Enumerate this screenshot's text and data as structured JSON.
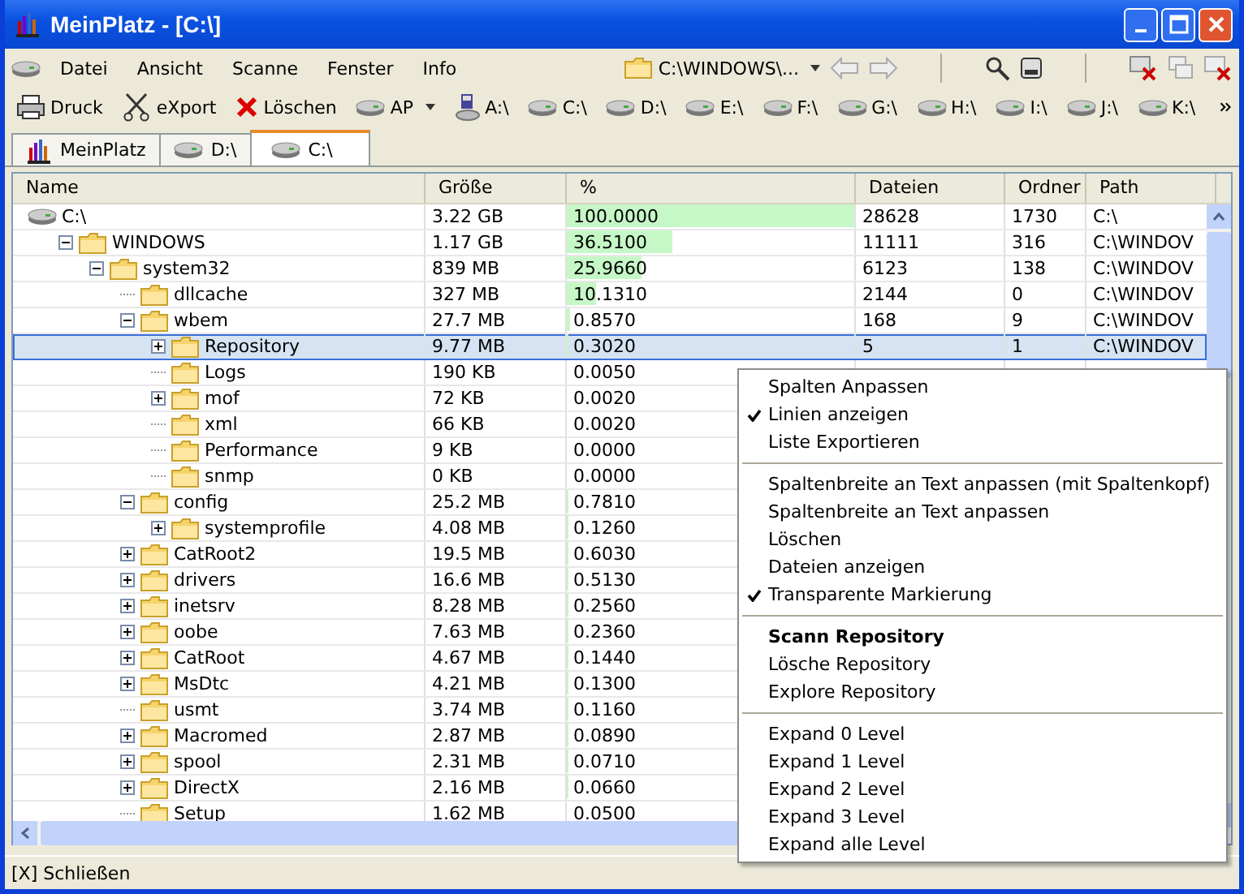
{
  "window": {
    "title": "MeinPlatz - [C:\\]"
  },
  "menu": [
    "Datei",
    "Ansicht",
    "Scanne",
    "Fenster",
    "Info"
  ],
  "address": {
    "value": "C:\\WINDOWS\\..."
  },
  "toolbar": [
    {
      "label": "Druck",
      "kind": "print"
    },
    {
      "label": "eXport",
      "kind": "export"
    },
    {
      "label": "Löschen",
      "kind": "delete"
    },
    {
      "label": "AP",
      "kind": "dropdown"
    },
    {
      "label": "A:\\",
      "kind": "floppy"
    },
    {
      "label": "C:\\",
      "kind": "drive"
    },
    {
      "label": "D:\\",
      "kind": "drive"
    },
    {
      "label": "E:\\",
      "kind": "drive"
    },
    {
      "label": "F:\\",
      "kind": "drive"
    },
    {
      "label": "G:\\",
      "kind": "drive"
    },
    {
      "label": "H:\\",
      "kind": "drive"
    },
    {
      "label": "I:\\",
      "kind": "drive"
    },
    {
      "label": "J:\\",
      "kind": "drive"
    },
    {
      "label": "K:\\",
      "kind": "drive"
    }
  ],
  "tabs": [
    {
      "label": "MeinPlatz",
      "kind": "app",
      "selected": false
    },
    {
      "label": "D:\\",
      "kind": "drive",
      "selected": false
    },
    {
      "label": "C:\\",
      "kind": "drive",
      "selected": true
    }
  ],
  "table": {
    "columns": [
      "Name",
      "Größe",
      "%",
      "Dateien",
      "Ordner",
      "Path"
    ],
    "rows": [
      {
        "name": "C:\\",
        "kind": "drive",
        "size": "3.22 GB",
        "pct": "100.0000",
        "level": 1,
        "files": "28628",
        "folders": "1730",
        "path": "C:\\",
        "selected": false,
        "children": [
          {
            "name": "WINDOWS",
            "kind": "folder",
            "expanded": true,
            "size": "1.17 GB",
            "pct": "36.5100",
            "level": 0.365,
            "files": "11111",
            "folders": "316",
            "path": "C:\\WINDOV",
            "selected": false,
            "children": [
              {
                "name": "system32",
                "kind": "folder",
                "expanded": true,
                "size": "839 MB",
                "pct": "25.9660",
                "level": 0.26,
                "files": "6123",
                "folders": "138",
                "path": "C:\\WINDOV",
                "selected": false,
                "children": [
                  {
                    "name": "dllcache",
                    "kind": "folder",
                    "size": "327 MB",
                    "pct": "10.1310",
                    "level": 0.101,
                    "files": "2144",
                    "folders": "0",
                    "path": "C:\\WINDOV",
                    "selected": false
                  },
                  {
                    "name": "wbem",
                    "kind": "folder",
                    "expanded": true,
                    "size": "27.7 MB",
                    "pct": "0.8570",
                    "level": 0.009,
                    "files": "168",
                    "folders": "9",
                    "path": "C:\\WINDOV",
                    "selected": false,
                    "children": [
                      {
                        "name": "Repository",
                        "kind": "folder",
                        "expanded": false,
                        "size": "9.77 MB",
                        "pct": "0.3020",
                        "level": 0.003,
                        "files": "5",
                        "folders": "1",
                        "path": "C:\\WINDOV",
                        "selected": true
                      },
                      {
                        "name": "Logs",
                        "kind": "folder",
                        "size": "190 KB",
                        "pct": "0.0050",
                        "level": 0,
                        "selected": false
                      },
                      {
                        "name": "mof",
                        "kind": "folder",
                        "expanded": false,
                        "size": "72 KB",
                        "pct": "0.0020",
                        "level": 0,
                        "selected": false
                      },
                      {
                        "name": "xml",
                        "kind": "folder",
                        "size": "66 KB",
                        "pct": "0.0020",
                        "level": 0,
                        "selected": false
                      },
                      {
                        "name": "Performance",
                        "kind": "folder",
                        "size": "9 KB",
                        "pct": "0.0000",
                        "level": 0,
                        "selected": false
                      },
                      {
                        "name": "snmp",
                        "kind": "folder",
                        "size": "0 KB",
                        "pct": "0.0000",
                        "level": 0,
                        "selected": false
                      }
                    ]
                  },
                  {
                    "name": "config",
                    "kind": "folder",
                    "expanded": true,
                    "size": "25.2 MB",
                    "pct": "0.7810",
                    "level": 0.008,
                    "selected": false,
                    "children": [
                      {
                        "name": "systemprofile",
                        "kind": "folder",
                        "expanded": false,
                        "size": "4.08 MB",
                        "pct": "0.1260",
                        "level": 0.001,
                        "selected": false
                      }
                    ]
                  },
                  {
                    "name": "CatRoot2",
                    "kind": "folder",
                    "expanded": false,
                    "size": "19.5 MB",
                    "pct": "0.6030",
                    "level": 0.006,
                    "selected": false
                  },
                  {
                    "name": "drivers",
                    "kind": "folder",
                    "expanded": false,
                    "size": "16.6 MB",
                    "pct": "0.5130",
                    "level": 0.005,
                    "selected": false
                  },
                  {
                    "name": "inetsrv",
                    "kind": "folder",
                    "expanded": false,
                    "size": "8.28 MB",
                    "pct": "0.2560",
                    "level": 0.003,
                    "selected": false
                  },
                  {
                    "name": "oobe",
                    "kind": "folder",
                    "expanded": false,
                    "size": "7.63 MB",
                    "pct": "0.2360",
                    "level": 0.002,
                    "selected": false
                  },
                  {
                    "name": "CatRoot",
                    "kind": "folder",
                    "expanded": false,
                    "size": "4.67 MB",
                    "pct": "0.1440",
                    "level": 0.001,
                    "selected": false
                  },
                  {
                    "name": "MsDtc",
                    "kind": "folder",
                    "expanded": false,
                    "size": "4.21 MB",
                    "pct": "0.1300",
                    "level": 0.001,
                    "selected": false
                  },
                  {
                    "name": "usmt",
                    "kind": "folder",
                    "size": "3.74 MB",
                    "pct": "0.1160",
                    "level": 0.001,
                    "selected": false
                  },
                  {
                    "name": "Macromed",
                    "kind": "folder",
                    "expanded": false,
                    "size": "2.87 MB",
                    "pct": "0.0890",
                    "level": 0.001,
                    "selected": false
                  },
                  {
                    "name": "spool",
                    "kind": "folder",
                    "expanded": false,
                    "size": "2.31 MB",
                    "pct": "0.0710",
                    "level": 0.001,
                    "selected": false
                  },
                  {
                    "name": "DirectX",
                    "kind": "folder",
                    "expanded": false,
                    "size": "2.16 MB",
                    "pct": "0.0660",
                    "level": 0.001,
                    "selected": false
                  },
                  {
                    "name": "Setup",
                    "kind": "folder",
                    "size": "1.62 MB",
                    "pct": "0.0500",
                    "level": 0,
                    "selected": false
                  }
                ]
              }
            ]
          }
        ]
      }
    ]
  },
  "context_menu": [
    [
      {
        "label": "Spalten Anpassen",
        "checked": false,
        "default": false
      },
      {
        "label": "Linien anzeigen",
        "checked": true,
        "default": false
      },
      {
        "label": "Liste Exportieren",
        "checked": false,
        "default": false
      }
    ],
    [
      {
        "label": "Spaltenbreite an Text anpassen (mit Spaltenkopf)",
        "checked": false,
        "default": false
      },
      {
        "label": "Spaltenbreite an Text anpassen",
        "checked": false,
        "default": false
      },
      {
        "label": "Löschen",
        "checked": false,
        "default": false
      },
      {
        "label": "Dateien anzeigen",
        "checked": false,
        "default": false
      },
      {
        "label": "Transparente Markierung",
        "checked": true,
        "default": false
      }
    ],
    [
      {
        "label": "Scann Repository",
        "checked": false,
        "default": true
      },
      {
        "label": "Lösche Repository",
        "checked": false,
        "default": false
      },
      {
        "label": "Explore Repository",
        "checked": false,
        "default": false
      }
    ],
    [
      {
        "label": "Expand 0 Level",
        "checked": false,
        "default": false
      },
      {
        "label": "Expand 1 Level",
        "checked": false,
        "default": false
      },
      {
        "label": "Expand 2 Level",
        "checked": false,
        "default": false
      },
      {
        "label": "Expand 3 Level",
        "checked": false,
        "default": false
      },
      {
        "label": "Expand alle Level",
        "checked": false,
        "default": false
      }
    ]
  ],
  "status_bar": "[X] Schließen"
}
